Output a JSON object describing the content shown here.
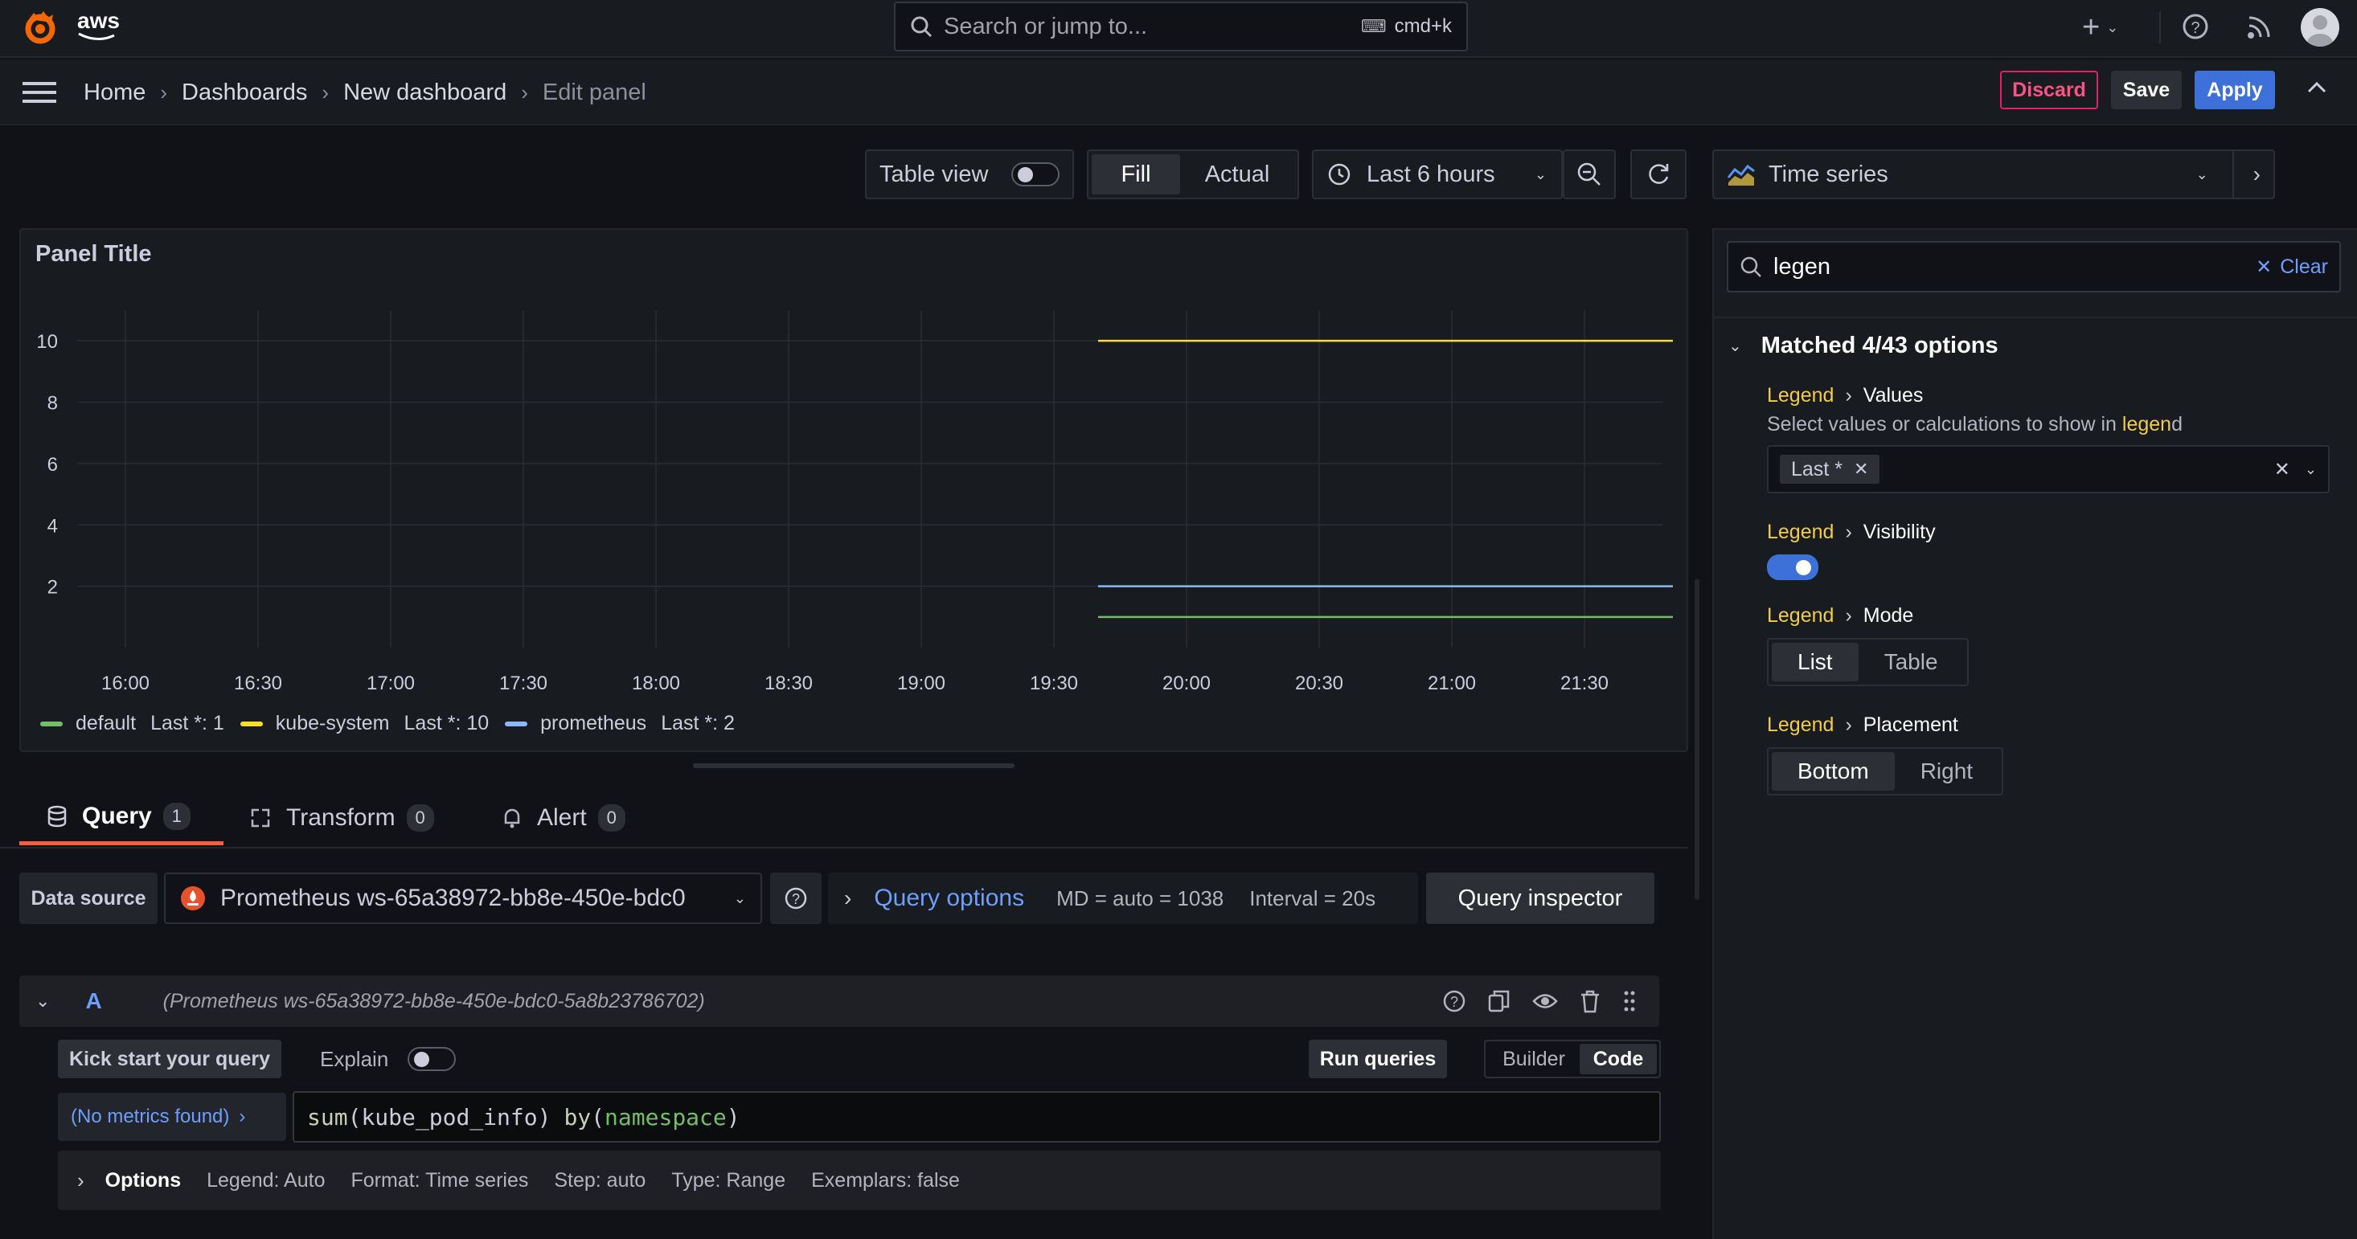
{
  "topbar": {
    "logo_text": "aws",
    "search_placeholder": "Search or jump to...",
    "search_shortcut": "cmd+k"
  },
  "breadcrumb": [
    "Home",
    "Dashboards",
    "New dashboard",
    "Edit panel"
  ],
  "actions": {
    "discard": "Discard",
    "save": "Save",
    "apply": "Apply"
  },
  "toolbar": {
    "table_view": "Table view",
    "fill": "Fill",
    "actual": "Actual",
    "time_range": "Last 6 hours"
  },
  "panel": {
    "title": "Panel Title",
    "viz_type": "Time series"
  },
  "chart_data": {
    "type": "line",
    "title": "Panel Title",
    "x": [
      "19:40",
      "21:50"
    ],
    "x_ticks": [
      "16:00",
      "16:30",
      "17:00",
      "17:30",
      "18:00",
      "18:30",
      "19:00",
      "19:30",
      "20:00",
      "20:30",
      "21:00",
      "21:30"
    ],
    "y_ticks": [
      2,
      4,
      6,
      8,
      10
    ],
    "ylim": [
      0,
      11
    ],
    "grid": true,
    "legend_position": "bottom",
    "series": [
      {
        "name": "default",
        "values": [
          1,
          1
        ],
        "color": "#73bf69",
        "legend_value": "Last *: 1"
      },
      {
        "name": "kube-system",
        "values": [
          10,
          10
        ],
        "color": "#fade2a",
        "legend_value": "Last *: 10"
      },
      {
        "name": "prometheus",
        "values": [
          2,
          2
        ],
        "color": "#8ab8ff",
        "legend_value": "Last *: 2"
      }
    ]
  },
  "tabs": [
    {
      "label": "Query",
      "count": "1"
    },
    {
      "label": "Transform",
      "count": "0"
    },
    {
      "label": "Alert",
      "count": "0"
    }
  ],
  "query_bar": {
    "data_source_label": "Data source",
    "data_source_value": "Prometheus ws-65a38972-bb8e-450e-bdc0",
    "query_options": "Query options",
    "md": "MD = auto = 1038",
    "interval": "Interval = 20s",
    "inspector": "Query inspector"
  },
  "query": {
    "ref": "A",
    "source_hint": "(Prometheus ws-65a38972-bb8e-450e-bdc0-5a8b23786702)",
    "kick_start": "Kick start your query",
    "explain": "Explain",
    "run": "Run queries",
    "builder": "Builder",
    "code": "Code",
    "metrics_browser": "(No metrics found)",
    "expr": {
      "fn": "sum",
      "open": "(",
      "metric": "kube_pod_info",
      "close": ")",
      "by": "by",
      "label": "namespace"
    },
    "options_label": "Options",
    "options": [
      "Legend: Auto",
      "Format: Time series",
      "Step: auto",
      "Type: Range",
      "Exemplars: false"
    ]
  },
  "sidebar": {
    "search_value": "legen",
    "clear": "Clear",
    "matched": "Matched 4/43 options",
    "legend_word": "Legend",
    "values_title": "Values",
    "values_desc_prefix": "Select values or calculations to show in ",
    "values_desc_hl": "legen",
    "values_desc_suffix": "d",
    "values_chip": "Last *",
    "visibility_title": "Visibility",
    "visibility_on": true,
    "mode_title": "Mode",
    "mode_list": "List",
    "mode_table": "Table",
    "placement_title": "Placement",
    "placement_bottom": "Bottom",
    "placement_right": "Right"
  }
}
